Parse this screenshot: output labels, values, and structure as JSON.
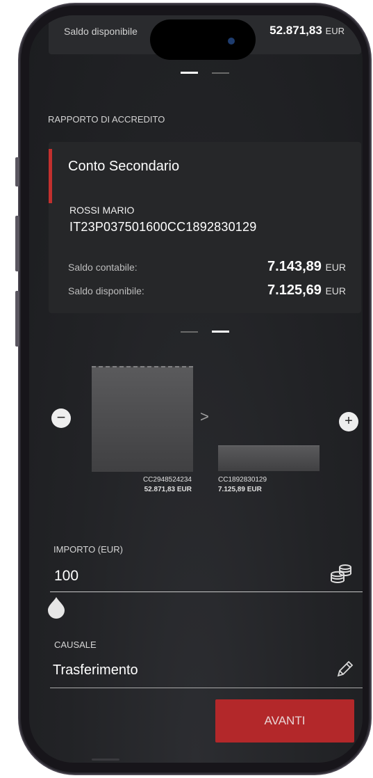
{
  "top_card": {
    "label": "Saldo disponibile",
    "amount": "52.871,83",
    "currency": "EUR"
  },
  "section_title": "RAPPORTO DI ACCREDITO",
  "account": {
    "name": "Conto Secondario",
    "holder": "ROSSI MARIO",
    "iban": "IT23P037501600CC1892830129",
    "balance_label": "Saldo contabile:",
    "balance_amount": "7.143,89",
    "available_label": "Saldo disponibile:",
    "available_amount": "7.125,69",
    "currency": "EUR"
  },
  "transfer_chart": {
    "from_account": "CC2948524234",
    "from_amount": "52.871,83 EUR",
    "to_account": "CC1892830129",
    "to_amount": "7.125,89 EUR",
    "arrow": ">"
  },
  "amount_field": {
    "label": "IMPORTO (EUR)",
    "value": "100",
    "icon": "coins-icon"
  },
  "slider": {
    "value_fraction": 0.0
  },
  "reason_field": {
    "label": "CAUSALE",
    "value": "Trasferimento",
    "icon": "pencil-icon"
  },
  "buttons": {
    "minus": "−",
    "plus": "+",
    "next": "AVANTI"
  },
  "colors": {
    "accent": "#b3282a",
    "background": "#222326",
    "card": "#262729"
  }
}
